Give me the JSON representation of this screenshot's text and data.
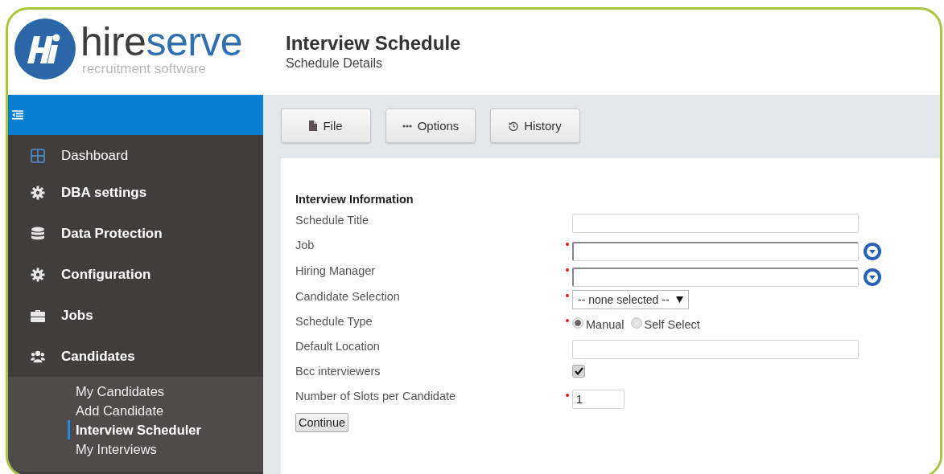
{
  "logo": {
    "wordmark": [
      {
        "text": "hire",
        "color": "#3f3c3c"
      },
      {
        "text": "serve",
        "color": "#2f6fb0"
      }
    ],
    "tagline": "recruitment software"
  },
  "header": {
    "title": "Interview Schedule",
    "subtitle": "Schedule Details"
  },
  "sidebar": {
    "items": [
      {
        "label": "Dashboard",
        "kind": "plain"
      },
      {
        "label": "DBA settings",
        "kind": "group"
      },
      {
        "label": "Data Protection",
        "kind": "group"
      },
      {
        "label": "Configuration",
        "kind": "group"
      },
      {
        "label": "Jobs",
        "kind": "group"
      },
      {
        "label": "Candidates",
        "kind": "group",
        "expanded": true,
        "children": [
          {
            "label": "My Candidates",
            "selected": false
          },
          {
            "label": "Add Candidate",
            "selected": false
          },
          {
            "label": "Interview Scheduler",
            "selected": true
          },
          {
            "label": "My Interviews",
            "selected": false
          }
        ]
      }
    ]
  },
  "toolbar": [
    {
      "label": "File"
    },
    {
      "label": "Options"
    },
    {
      "label": "History"
    }
  ],
  "form": {
    "section_title": "Interview Information",
    "fields": [
      {
        "label": "Schedule Title",
        "kind": "text",
        "required": false
      },
      {
        "label": "Job",
        "kind": "lookup",
        "required": true
      },
      {
        "label": "Hiring Manager",
        "kind": "lookup",
        "required": true
      },
      {
        "label": "Candidate Selection",
        "kind": "select",
        "required": true,
        "value": "-- none selected --"
      },
      {
        "label": "Schedule Type",
        "kind": "radio",
        "required": true,
        "options": [
          {
            "label": "Manual",
            "selected": true
          },
          {
            "label": "Self Select",
            "selected": false
          }
        ]
      },
      {
        "label": "Default Location",
        "kind": "text",
        "required": false
      },
      {
        "label": "Bcc interviewers",
        "kind": "checkbox",
        "required": false,
        "checked": true
      },
      {
        "label": "Number of Slots per Candidate",
        "kind": "number",
        "required": true,
        "value": "1"
      }
    ],
    "submit": "Continue"
  }
}
